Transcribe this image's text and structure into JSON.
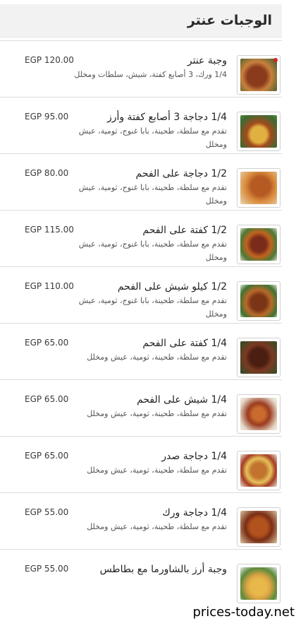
{
  "header": {
    "title": "الوجبات عنتر"
  },
  "items": [
    {
      "name": "وجبة عنتر",
      "desc": "1/4 ورك، 3 أصابع كفتة، شيش، سلطات ومخلل",
      "price": "EGP 120.00",
      "thumb": "food-photo-kofta-platter"
    },
    {
      "name": "1/4 دجاجة 3 أصابع كفتة وأرز",
      "desc": "تقدم مع سلطة، طحينة، بابا غنوج، ثومية، عيش ومخلل",
      "price": "EGP 95.00",
      "thumb": "food-photo-chicken-rice"
    },
    {
      "name": "1/2 دجاجة على الفحم",
      "desc": "تقدم مع سلطة، طحينة، بابا غنوج، ثومية، عيش ومخلل",
      "price": "EGP 80.00",
      "thumb": "food-photo-grilled-chicken"
    },
    {
      "name": "1/2 كفتة على الفحم",
      "desc": "تقدم مع سلطة، طحينة، بابا غنوج، ثومية، عيش ومخلل",
      "price": "EGP 115.00",
      "thumb": "food-photo-kofta"
    },
    {
      "name": "1/2 كيلو شيش على الفحم",
      "desc": "تقدم مع سلطة، طحينة، بابا غنوج، ثومية، عيش ومخلل",
      "price": "EGP 110.00",
      "thumb": "food-photo-shish"
    },
    {
      "name": "1/4 كفتة على الفحم",
      "desc": "تقدم مع سلطة، طحينة، ثومية، عيش ومخلل",
      "price": "EGP 65.00",
      "thumb": "food-photo-kofta-small"
    },
    {
      "name": "1/4 شيش على الفحم",
      "desc": "تقدم مع سلطة، طحينة، ثومية، عيش ومخلل",
      "price": "EGP 65.00",
      "thumb": "food-photo-skewers"
    },
    {
      "name": "1/4 دجاجة صدر",
      "desc": "تقدم مع سلطة، طحينة، ثومية، عيش ومخلل",
      "price": "EGP 65.00",
      "thumb": "food-photo-chicken-breast"
    },
    {
      "name": "1/4 دجاجة ورك",
      "desc": "تقدم مع سلطة، طحينة، ثومية، عيش ومخلل",
      "price": "EGP 55.00",
      "thumb": "food-photo-chicken-leg"
    },
    {
      "name": "وجبة أرز بالشاورما مع بطاطس",
      "desc": "",
      "price": "EGP 55.00",
      "thumb": "food-photo-shawarma-rice"
    }
  ],
  "watermark": "prices-today.net",
  "colors": {
    "header_bg": "#f2f2f2",
    "divider": "#dcdcdc",
    "badge": "#d92323"
  }
}
